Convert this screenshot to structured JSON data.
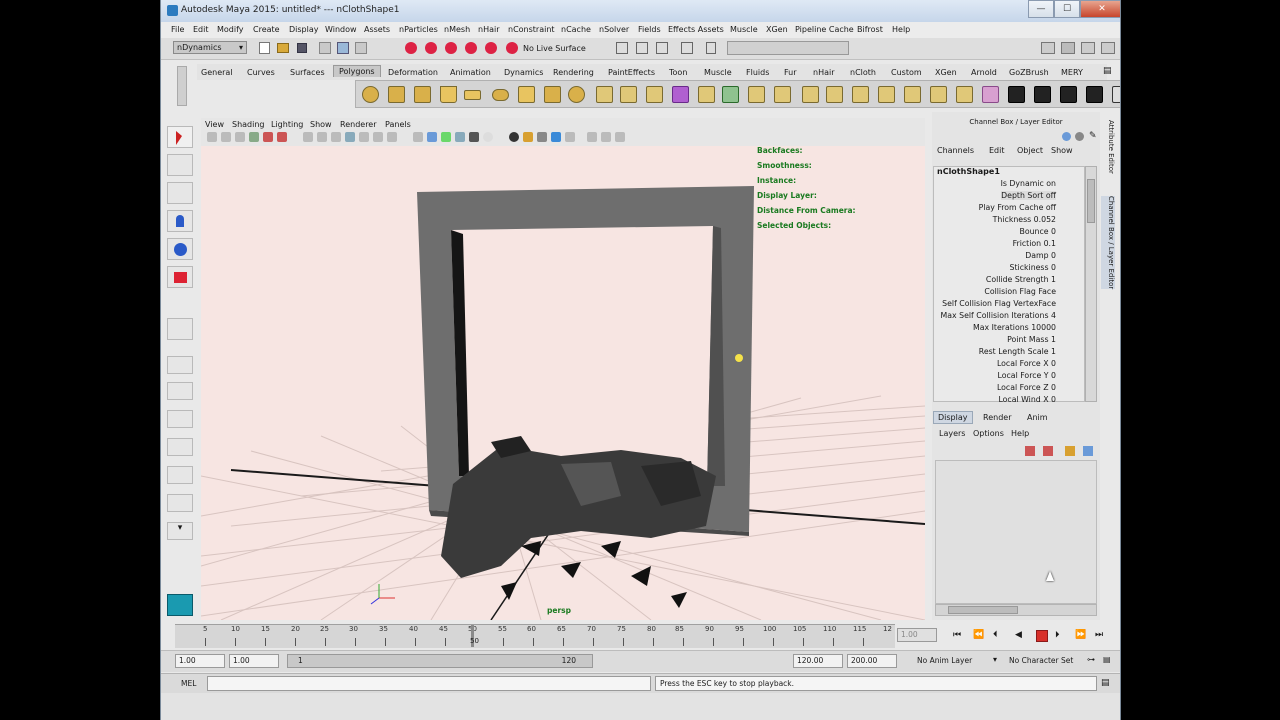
{
  "window": {
    "title": "Autodesk Maya 2015: untitled*   ---   nClothShape1",
    "min": "—",
    "max": "☐",
    "close": "✕"
  },
  "menu": [
    "File",
    "Edit",
    "Modify",
    "Create",
    "Display",
    "Window",
    "Assets",
    "nParticles",
    "nMesh",
    "nHair",
    "nConstraint",
    "nCache",
    "nSolver",
    "Fields",
    "Effects Assets",
    "Muscle",
    "XGen",
    "Pipeline Cache",
    "Bifrost",
    "Help"
  ],
  "status": {
    "menuset": "nDynamics",
    "live_surface": "No Live Surface"
  },
  "shelf_tabs": [
    "General",
    "Curves",
    "Surfaces",
    "Polygons",
    "Deformation",
    "Animation",
    "Dynamics",
    "Rendering",
    "PaintEffects",
    "Toon",
    "Muscle",
    "Fluids",
    "Fur",
    "nHair",
    "nCloth",
    "Custom",
    "XGen",
    "Arnold",
    "GoZBrush",
    "MERY"
  ],
  "shelf_active": "Polygons",
  "viewport": {
    "menu": [
      "View",
      "Shading",
      "Lighting",
      "Show",
      "Renderer",
      "Panels"
    ],
    "hud_labels": [
      "Backfaces:",
      "Smoothness:",
      "Instance:",
      "Display Layer:",
      "Distance From Camera:",
      "Selected Objects:"
    ],
    "camera": "persp"
  },
  "channel_box": {
    "title": "Channel Box / Layer Editor",
    "menu": [
      "Channels",
      "Edit",
      "Object",
      "Show"
    ],
    "node": "nClothShape1",
    "attributes": [
      "Is Dynamic on",
      "Depth Sort off",
      "Play From Cache off",
      "Thickness 0.052",
      "Bounce 0",
      "Friction 0.1",
      "Damp 0",
      "Stickiness 0",
      "Collide Strength 1",
      "Collision Flag Face",
      "Self Collision Flag VertexFace",
      "Max Self Collision Iterations 4",
      "Max Iterations 10000",
      "Point Mass 1",
      "Rest Length Scale 1",
      "Local Force X 0",
      "Local Force Y 0",
      "Local Force Z 0",
      "Local Wind X 0"
    ],
    "side_tabs": [
      "Attribute Editor",
      "Channel Box / Layer Editor"
    ]
  },
  "layer_editor": {
    "tabs": [
      "Display",
      "Render",
      "Anim"
    ],
    "menu": [
      "Layers",
      "Options",
      "Help"
    ]
  },
  "timeline": {
    "ticks": [
      "5",
      "10",
      "15",
      "20",
      "25",
      "30",
      "35",
      "40",
      "45",
      "50",
      "55",
      "60",
      "65",
      "70",
      "75",
      "80",
      "85",
      "90",
      "95",
      "100",
      "105",
      "110",
      "115",
      "12"
    ],
    "current": "50",
    "current_field": "1.00"
  },
  "range": {
    "start": "1.00",
    "start2": "1.00",
    "slider_start": "1",
    "slider_end": "120",
    "end": "120.00",
    "end2": "200.00",
    "anim_layer": "No Anim Layer",
    "char_set": "No Character Set"
  },
  "command": {
    "label": "MEL",
    "result": "Press the ESC key to stop playback."
  },
  "colors": {
    "viewport_bg": "#f7e5e2",
    "frame": "#6e6e6e",
    "hud_green": "#1a7a20"
  }
}
